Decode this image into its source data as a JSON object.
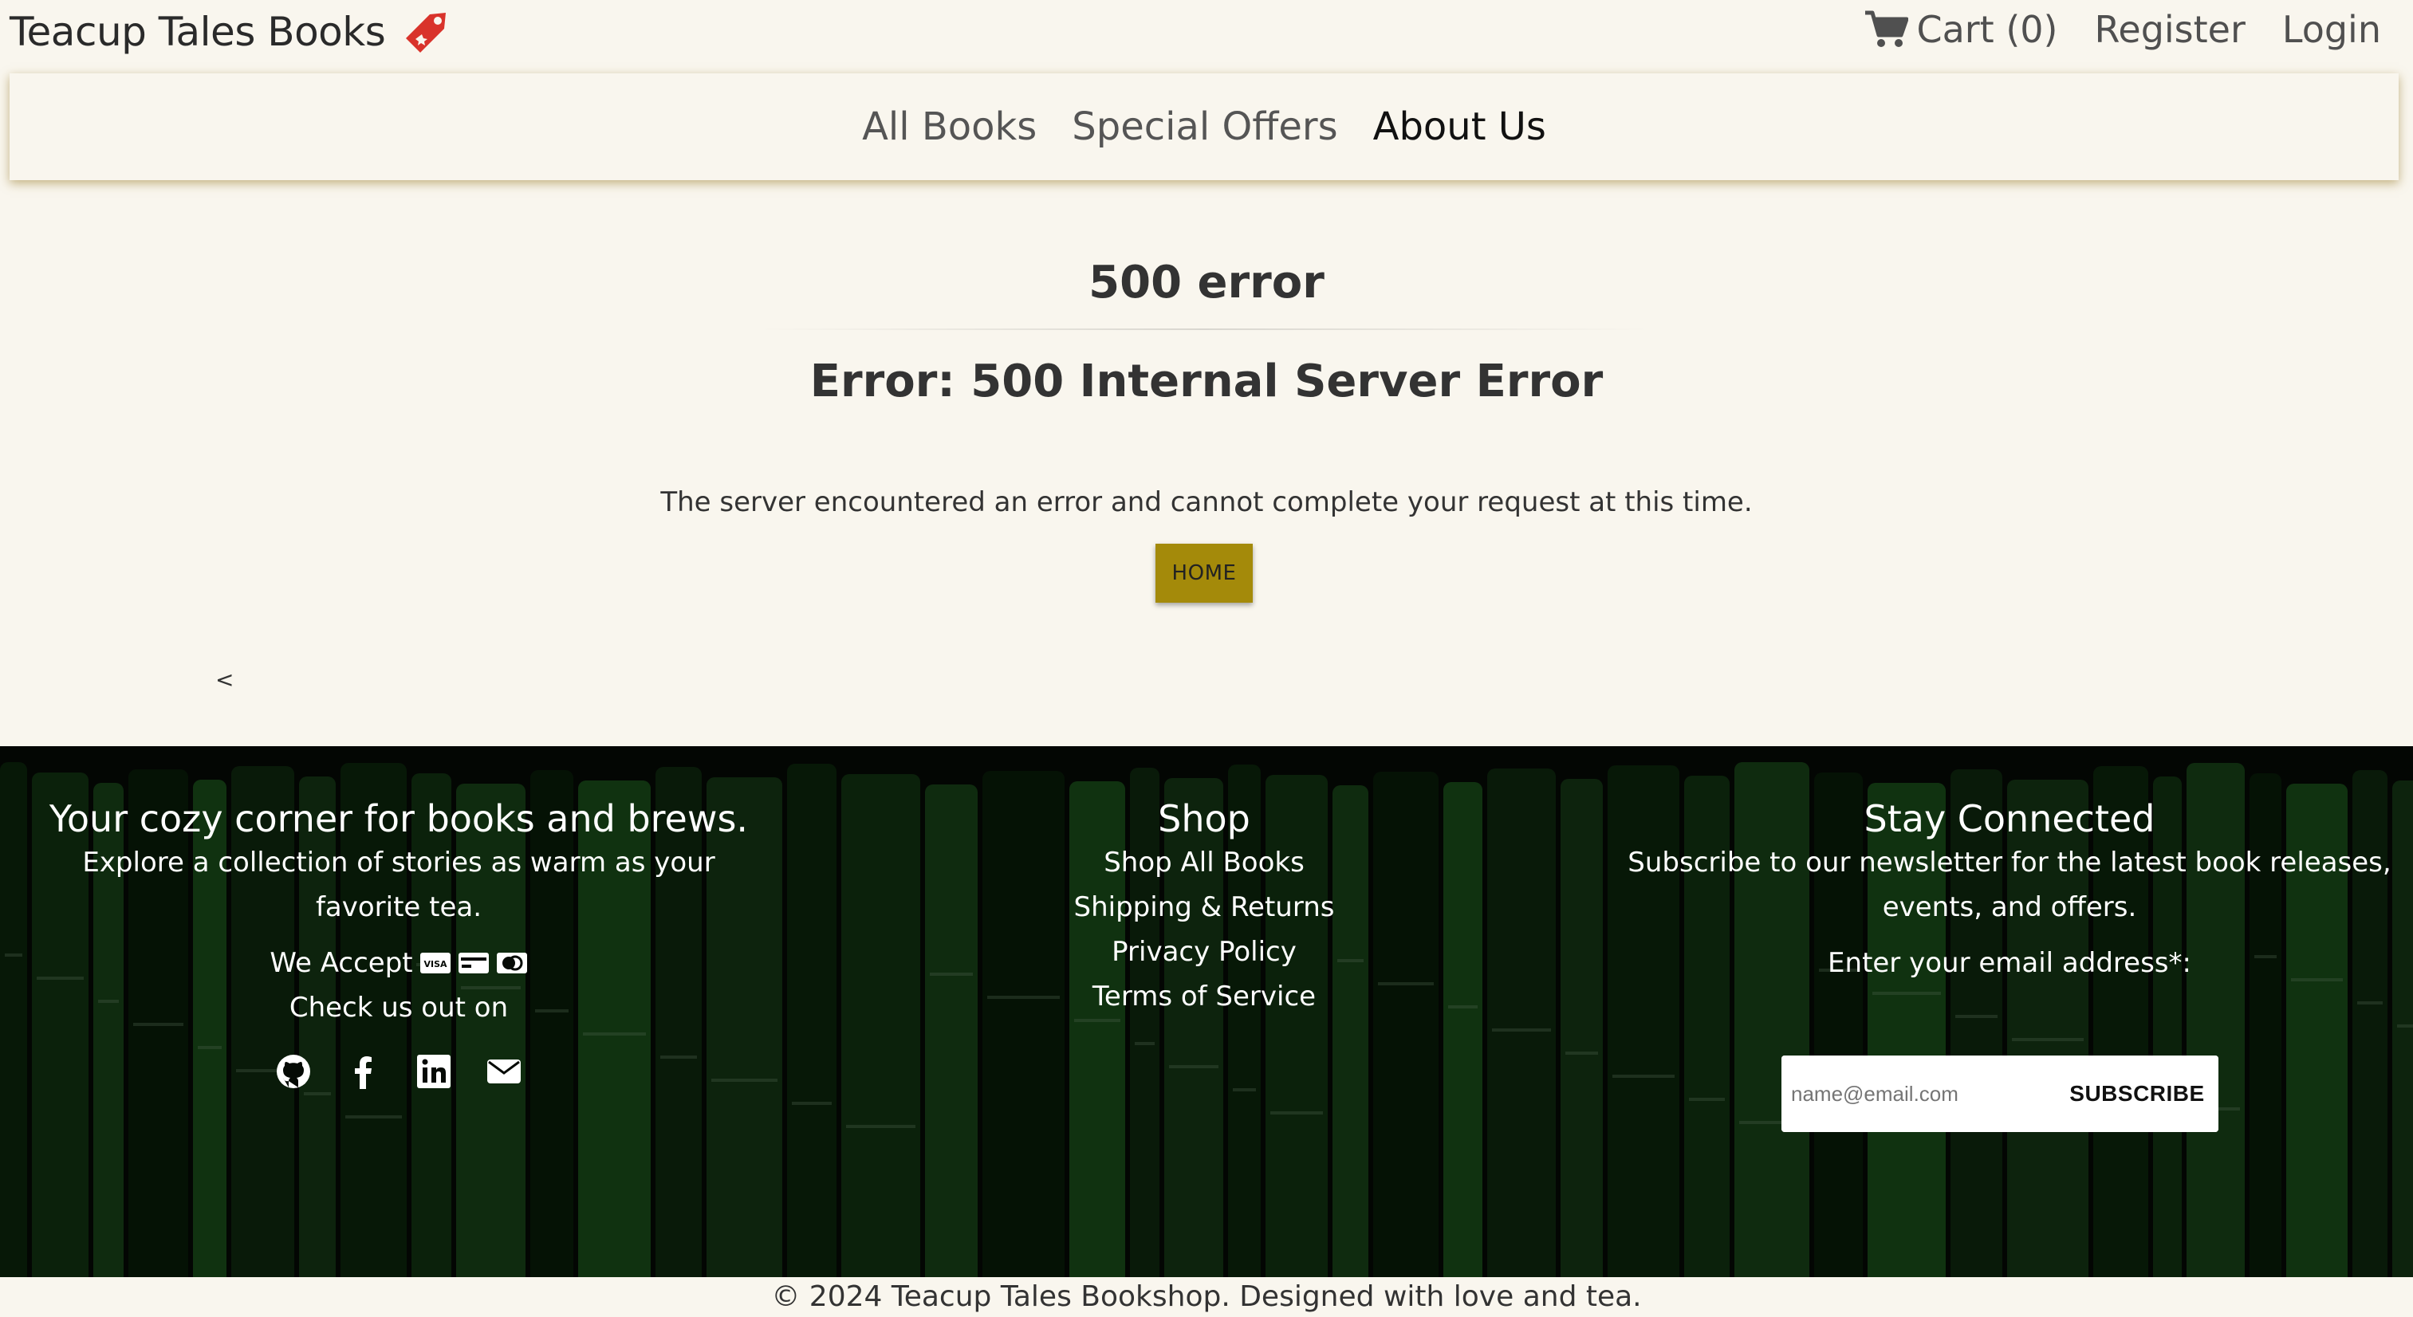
{
  "brand": {
    "name": "Teacup Tales Books",
    "logo_icon": "tag-icon"
  },
  "top_nav": {
    "cart_label": "Cart (0)",
    "register": "Register",
    "login": "Login"
  },
  "main_nav": {
    "items": [
      "All Books",
      "Special Offers",
      "About Us"
    ],
    "active": "About Us"
  },
  "error": {
    "title": "500 error",
    "subtitle": "Error: 500 Internal Server Error",
    "message": "The server encountered an error and cannot complete your request at this time.",
    "home_button": "HOME",
    "stray_text": "<"
  },
  "footer": {
    "tagline": "Your cozy corner for books and brews.",
    "description": "Explore a collection of stories as warm as your favorite tea.",
    "we_accept": "We Accept",
    "payment_icons": [
      "visa-card-icon",
      "credit-card-icon",
      "mastercard-icon"
    ],
    "check_us_out": "Check us out on",
    "social_icons": [
      "github-icon",
      "facebook-icon",
      "linkedin-icon",
      "envelope-icon"
    ],
    "shop_heading": "Shop",
    "shop_links": [
      "Shop All Books",
      "Shipping & Returns",
      "Privacy Policy",
      "Terms of Service"
    ],
    "stay_connected_heading": "Stay Connected",
    "newsletter_text": "Subscribe to our newsletter for the latest book releases, events, and offers.",
    "email_label": "Enter your email address*:",
    "email_placeholder": "name@email.com",
    "subscribe_button": "SUBSCRIBE",
    "copyright": "© 2024 Teacup Tales Bookshop. Designed with love and tea."
  },
  "colors": {
    "page_background": "#f9f6ee",
    "home_button": "#a48a0a",
    "logo_red": "#d9332b",
    "footer_green": "#1f5a1f"
  }
}
